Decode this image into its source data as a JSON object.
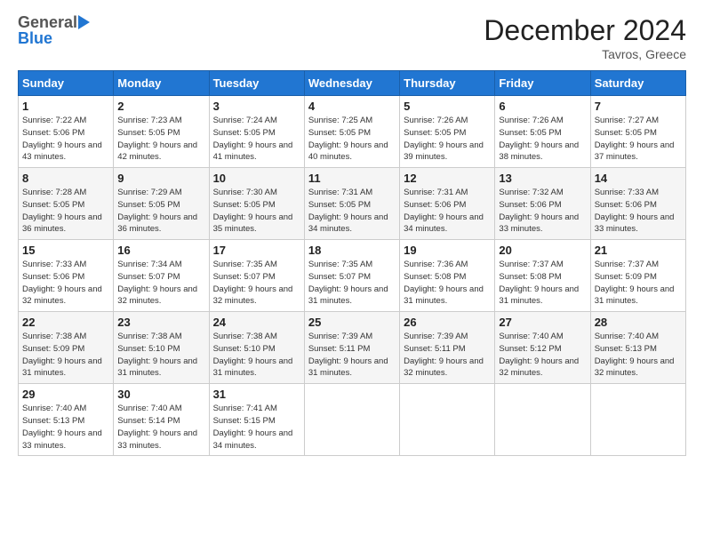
{
  "header": {
    "logo_general": "General",
    "logo_blue": "Blue",
    "month_title": "December 2024",
    "location": "Tavros, Greece"
  },
  "calendar": {
    "headers": [
      "Sunday",
      "Monday",
      "Tuesday",
      "Wednesday",
      "Thursday",
      "Friday",
      "Saturday"
    ],
    "weeks": [
      [
        {
          "day": "1",
          "rise": "7:22 AM",
          "set": "5:06 PM",
          "daylight": "9 hours and 43 minutes."
        },
        {
          "day": "2",
          "rise": "7:23 AM",
          "set": "5:05 PM",
          "daylight": "9 hours and 42 minutes."
        },
        {
          "day": "3",
          "rise": "7:24 AM",
          "set": "5:05 PM",
          "daylight": "9 hours and 41 minutes."
        },
        {
          "day": "4",
          "rise": "7:25 AM",
          "set": "5:05 PM",
          "daylight": "9 hours and 40 minutes."
        },
        {
          "day": "5",
          "rise": "7:26 AM",
          "set": "5:05 PM",
          "daylight": "9 hours and 39 minutes."
        },
        {
          "day": "6",
          "rise": "7:26 AM",
          "set": "5:05 PM",
          "daylight": "9 hours and 38 minutes."
        },
        {
          "day": "7",
          "rise": "7:27 AM",
          "set": "5:05 PM",
          "daylight": "9 hours and 37 minutes."
        }
      ],
      [
        {
          "day": "8",
          "rise": "7:28 AM",
          "set": "5:05 PM",
          "daylight": "9 hours and 36 minutes."
        },
        {
          "day": "9",
          "rise": "7:29 AM",
          "set": "5:05 PM",
          "daylight": "9 hours and 36 minutes."
        },
        {
          "day": "10",
          "rise": "7:30 AM",
          "set": "5:05 PM",
          "daylight": "9 hours and 35 minutes."
        },
        {
          "day": "11",
          "rise": "7:31 AM",
          "set": "5:05 PM",
          "daylight": "9 hours and 34 minutes."
        },
        {
          "day": "12",
          "rise": "7:31 AM",
          "set": "5:06 PM",
          "daylight": "9 hours and 34 minutes."
        },
        {
          "day": "13",
          "rise": "7:32 AM",
          "set": "5:06 PM",
          "daylight": "9 hours and 33 minutes."
        },
        {
          "day": "14",
          "rise": "7:33 AM",
          "set": "5:06 PM",
          "daylight": "9 hours and 33 minutes."
        }
      ],
      [
        {
          "day": "15",
          "rise": "7:33 AM",
          "set": "5:06 PM",
          "daylight": "9 hours and 32 minutes."
        },
        {
          "day": "16",
          "rise": "7:34 AM",
          "set": "5:07 PM",
          "daylight": "9 hours and 32 minutes."
        },
        {
          "day": "17",
          "rise": "7:35 AM",
          "set": "5:07 PM",
          "daylight": "9 hours and 32 minutes."
        },
        {
          "day": "18",
          "rise": "7:35 AM",
          "set": "5:07 PM",
          "daylight": "9 hours and 31 minutes."
        },
        {
          "day": "19",
          "rise": "7:36 AM",
          "set": "5:08 PM",
          "daylight": "9 hours and 31 minutes."
        },
        {
          "day": "20",
          "rise": "7:37 AM",
          "set": "5:08 PM",
          "daylight": "9 hours and 31 minutes."
        },
        {
          "day": "21",
          "rise": "7:37 AM",
          "set": "5:09 PM",
          "daylight": "9 hours and 31 minutes."
        }
      ],
      [
        {
          "day": "22",
          "rise": "7:38 AM",
          "set": "5:09 PM",
          "daylight": "9 hours and 31 minutes."
        },
        {
          "day": "23",
          "rise": "7:38 AM",
          "set": "5:10 PM",
          "daylight": "9 hours and 31 minutes."
        },
        {
          "day": "24",
          "rise": "7:38 AM",
          "set": "5:10 PM",
          "daylight": "9 hours and 31 minutes."
        },
        {
          "day": "25",
          "rise": "7:39 AM",
          "set": "5:11 PM",
          "daylight": "9 hours and 31 minutes."
        },
        {
          "day": "26",
          "rise": "7:39 AM",
          "set": "5:11 PM",
          "daylight": "9 hours and 32 minutes."
        },
        {
          "day": "27",
          "rise": "7:40 AM",
          "set": "5:12 PM",
          "daylight": "9 hours and 32 minutes."
        },
        {
          "day": "28",
          "rise": "7:40 AM",
          "set": "5:13 PM",
          "daylight": "9 hours and 32 minutes."
        }
      ],
      [
        {
          "day": "29",
          "rise": "7:40 AM",
          "set": "5:13 PM",
          "daylight": "9 hours and 33 minutes."
        },
        {
          "day": "30",
          "rise": "7:40 AM",
          "set": "5:14 PM",
          "daylight": "9 hours and 33 minutes."
        },
        {
          "day": "31",
          "rise": "7:41 AM",
          "set": "5:15 PM",
          "daylight": "9 hours and 34 minutes."
        },
        null,
        null,
        null,
        null
      ]
    ]
  }
}
